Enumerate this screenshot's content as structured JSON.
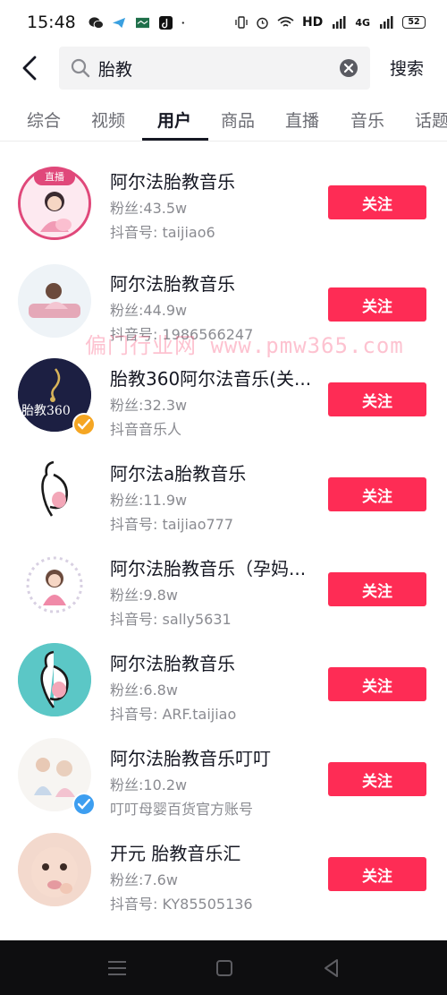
{
  "status_bar": {
    "time": "15:48",
    "hd_label": "HD",
    "signal_label": "4G",
    "battery": "52"
  },
  "search": {
    "query": "胎教",
    "submit_label": "搜索"
  },
  "tabs": [
    {
      "label": "综合",
      "active": false
    },
    {
      "label": "视频",
      "active": false
    },
    {
      "label": "用户",
      "active": true
    },
    {
      "label": "商品",
      "active": false
    },
    {
      "label": "直播",
      "active": false
    },
    {
      "label": "音乐",
      "active": false
    },
    {
      "label": "话题",
      "active": false
    }
  ],
  "users": [
    {
      "name": "阿尔法胎教音乐",
      "fans": "粉丝:43.5w",
      "id": "抖音号: taijiao6",
      "follow": "关注",
      "live_badge": "直播"
    },
    {
      "name": "阿尔法胎教音乐",
      "fans": "粉丝:44.9w",
      "id": "抖音号: 1986566247",
      "follow": "关注"
    },
    {
      "name": "胎教360阿尔法音乐(关...",
      "fans": "粉丝:32.3w",
      "id": "抖音音乐人",
      "follow": "关注",
      "avatar_text": "胎教360"
    },
    {
      "name": "阿尔法a胎教音乐",
      "fans": "粉丝:11.9w",
      "id": "抖音号: taijiao777",
      "follow": "关注"
    },
    {
      "name": "阿尔法胎教音乐（孕妈...",
      "fans": "粉丝:9.8w",
      "id": "抖音号: sally5631",
      "follow": "关注"
    },
    {
      "name": "阿尔法胎教音乐",
      "fans": "粉丝:6.8w",
      "id": "抖音号: ARF.taijiao",
      "follow": "关注"
    },
    {
      "name": "阿尔法胎教音乐叮叮",
      "fans": "粉丝:10.2w",
      "id": "叮叮母婴百货官方账号",
      "follow": "关注"
    },
    {
      "name": "开元 胎教音乐汇",
      "fans": "粉丝:7.6w",
      "id": "抖音号: KY85505136",
      "follow": "关注"
    }
  ],
  "watermark": "偏门行业网 www.pmw365.com",
  "colors": {
    "accent": "#fe2c55",
    "verified_orange": "#f5a623",
    "verified_blue": "#3d9ef0",
    "nav_bar": "#0e0e10"
  }
}
